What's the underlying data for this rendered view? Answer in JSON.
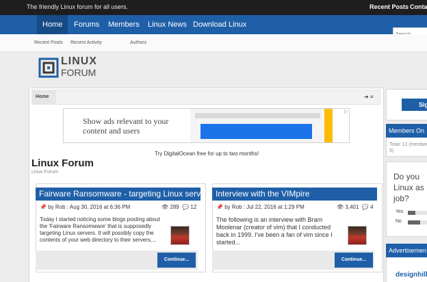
{
  "topbar": {
    "tagline": "The friendly Linux forum for all users.",
    "links": [
      "Recent Posts",
      "Contac"
    ]
  },
  "nav": {
    "items": [
      "Home",
      "Forums",
      "Members",
      "Linux News",
      "Download Linux"
    ],
    "search_placeholder": "Search..."
  },
  "subnav": {
    "items": [
      "Recent Posts",
      "Recent Activity",
      "Authors"
    ]
  },
  "logo": {
    "line1": "LINUX",
    "line2": "FORUM"
  },
  "breadcrumb": {
    "home": "Home"
  },
  "ad": {
    "text": "Show ads relevant to your content and users",
    "close": "▷"
  },
  "promo": "Try DigitalOcean free for up to two months!",
  "page": {
    "title": "Linux Forum",
    "subtitle": "Linux Forum"
  },
  "threads": [
    {
      "title": "Fairware Ransomware - targeting Linux servers",
      "author": "Rob",
      "date": "Aug 30, 2016 at 6:36 PM",
      "views": "289",
      "replies": "12",
      "body": "Today I started noticing some blogs posting about the 'Fairware Ransomware' that is supposedly targeting Linux servers. It will possibly copy the contents of your web directory to their servers,...",
      "button": "Continue..."
    },
    {
      "title": "Interview with the VIMpire",
      "author": "Rob",
      "date": "Jul 22, 2016 at 1:29 PM",
      "views": "3,401",
      "replies": "4",
      "body": "The following is an interview with Bram Moolenar (creator of vim) that I conducted back in 1999. I've been a fan of vim since I started...",
      "button": "Continue..."
    }
  ],
  "sidebar": {
    "sign_button": "Sig",
    "members_online": {
      "heading": "Members On",
      "text": "Total: 12 (member 5)"
    },
    "poll": {
      "question": "Do you Linux as job?",
      "options": [
        {
          "label": "Yes",
          "fraction": 0.35
        },
        {
          "label": "No",
          "fraction": 0.6
        }
      ]
    },
    "advert": {
      "heading": "Advertisemen",
      "logo_text": "designhill"
    }
  }
}
